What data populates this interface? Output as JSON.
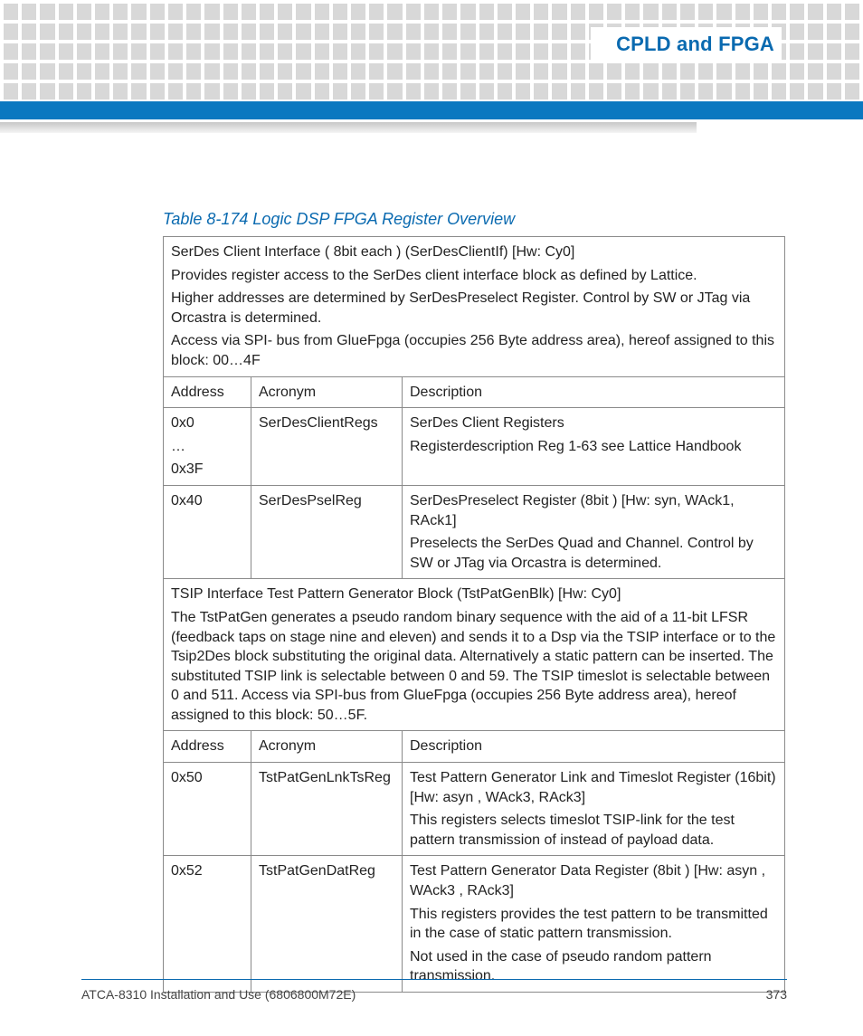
{
  "header": {
    "section_title": "CPLD and FPGA"
  },
  "caption": "Table 8-174 Logic DSP FPGA Register Overview",
  "block1": {
    "heading": "SerDes Client Interface ( 8bit each ) (SerDesClientIf) [Hw: Cy0]",
    "p1": "Provides register access to the SerDes client interface block as defined by Lattice.",
    "p2": "Higher addresses are determined by SerDesPreselect Register. Control by SW or JTag via Orcastra is determined.",
    "p3": "Access via SPI- bus from GlueFpga (occupies 256 Byte address area), hereof assigned to this block: 00…4F",
    "cols": {
      "c1": "Address",
      "c2": "Acronym",
      "c3": "Description"
    },
    "rows": [
      {
        "addr_l1": "0x0",
        "addr_l2": "…",
        "addr_l3": "0x3F",
        "acronym": "SerDesClientRegs",
        "desc_l1": "SerDes Client Registers",
        "desc_l2": "Registerdescription Reg 1-63 see Lattice Handbook"
      },
      {
        "addr": "0x40",
        "acronym": "SerDesPselReg",
        "desc_l1": "SerDesPreselect Register (8bit ) [Hw: syn, WAck1, RAck1]",
        "desc_l2": "Preselects the SerDes Quad and Channel. Control by SW or JTag via Orcastra is determined."
      }
    ]
  },
  "block2": {
    "heading": "TSIP Interface Test Pattern Generator Block (TstPatGenBlk) [Hw: Cy0]",
    "p1": "The TstPatGen generates a pseudo random binary sequence with the aid of a 11-bit LFSR (feedback taps on stage nine and eleven) and sends it to a Dsp via the TSIP interface or to the Tsip2Des block substituting the original data. Alternatively a static pattern can be inserted. The substituted TSIP link is selectable between 0 and 59. The TSIP timeslot is selectable between 0 and 511. Access via SPI-bus from GlueFpga (occupies 256 Byte address area), hereof assigned to this block: 50…5F.",
    "cols": {
      "c1": "Address",
      "c2": "Acronym",
      "c3": "Description"
    },
    "rows": [
      {
        "addr": "0x50",
        "acronym": "TstPatGenLnkTsReg",
        "desc_l1": "Test Pattern Generator Link and Timeslot Register (16bit) [Hw: asyn , WAck3, RAck3]",
        "desc_l2": "This registers selects timeslot TSIP-link for the test pattern transmission of instead of payload data."
      },
      {
        "addr": "0x52",
        "acronym": "TstPatGenDatReg",
        "desc_l1": "Test Pattern Generator Data Register (8bit ) [Hw: asyn , WAck3 , RAck3]",
        "desc_l2": "This registers provides the test pattern to be transmitted in the case of static pattern transmission.",
        "desc_l3": "Not used in the case of pseudo random pattern transmission."
      }
    ]
  },
  "footer": {
    "doc": "ATCA-8310 Installation and Use (6806800M72E)",
    "page": "373"
  }
}
